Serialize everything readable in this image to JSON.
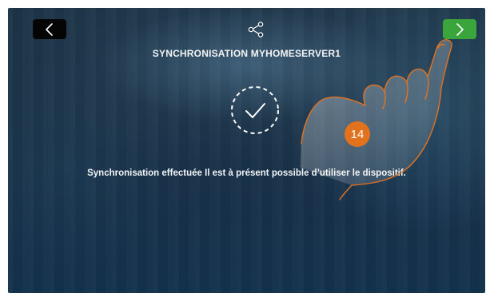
{
  "screen": {
    "title": "SYNCHRONISATION MYHOMESERVER1",
    "message": "Synchronisation effectuée Il est à présent possible d’utiliser le dispositif."
  },
  "navigation": {
    "back_icon": "chevron-left-icon",
    "next_icon": "chevron-right-icon",
    "share_icon": "share-icon"
  },
  "status": {
    "icon": "check-circle-dashed-icon"
  },
  "annotation": {
    "step_number": "14",
    "badge_color": "#e3721f"
  },
  "colors": {
    "next_button": "#3aa53b",
    "back_button": "#050505",
    "text": "#f2f4f6"
  }
}
